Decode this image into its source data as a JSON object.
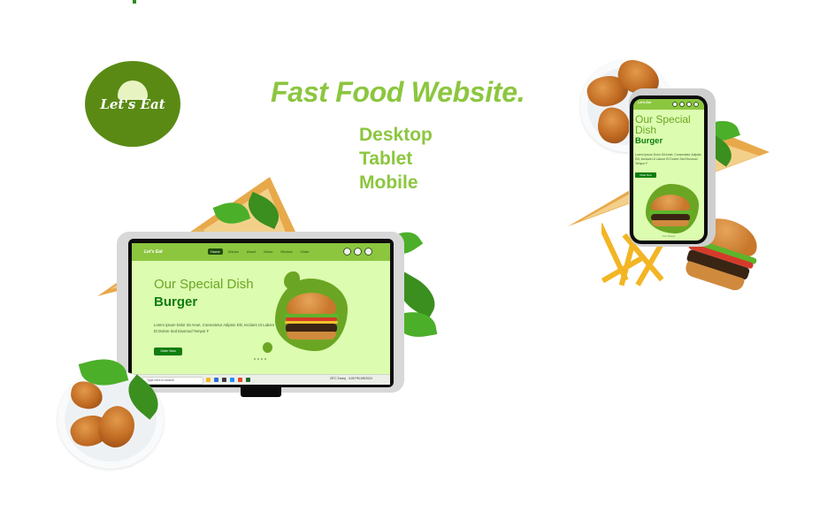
{
  "brand": {
    "logo_text": "Let's Eat"
  },
  "headline": "Fast Food Website.",
  "variants": [
    "Desktop",
    "Tablet",
    "Mobile"
  ],
  "desktop_site": {
    "logo_text": "Let's Eat",
    "nav": [
      "Home",
      "Dishes",
      "About",
      "Menu",
      "Review",
      "Order"
    ],
    "active_nav": "Home",
    "nav_icons": [
      "search-icon",
      "heart-icon",
      "cart-icon"
    ],
    "heading": "Our Special Dish",
    "dish": "Burger",
    "body": "Lorem Ipsum Dolor Sit Amet, Consectetur Adipisic Elit, Incidunt Ut Labore Et Dolore Sed Eiusmod Tempor F",
    "button": "Order Now"
  },
  "taskbar": {
    "search_placeholder": "Type here to search",
    "weather": "25°C Sunny",
    "time": "4:09 PM",
    "date": "6/9/2024"
  },
  "mobile_site": {
    "logo_text": "Let's Eat",
    "heading": "Our Special Dish",
    "dish": "Burger",
    "body": "Lorem Ipsum Dolor Sit Amet, Consectetur Adipisic Elit, Incidunt Ut Labore Et Dolore Sed Eiusmod Tempor F",
    "button": "Order Now",
    "footer_link": "Our Dishes"
  },
  "colors": {
    "brand_green": "#5a8a14",
    "accent_green": "#8cc63f",
    "screen_bg": "#dcfcb0",
    "dark_green": "#0f7d0f"
  }
}
